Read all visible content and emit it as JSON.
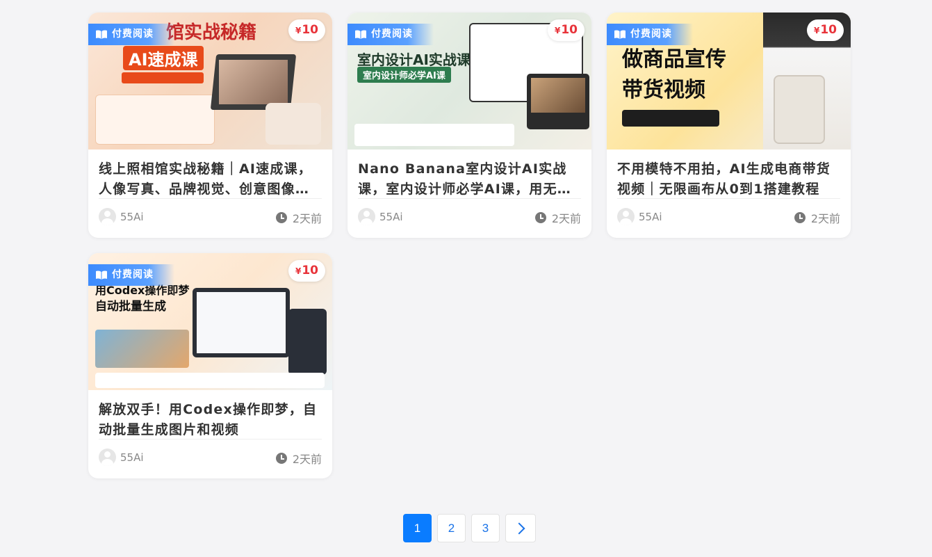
{
  "cards": [
    {
      "badge": "付费阅读",
      "price_symbol": "¥",
      "price": "10",
      "title": "线上照相馆实战秘籍｜AI速成课，人像写真、品牌视觉、创意图像一站式变现教学",
      "author": "55Ai",
      "time": "2天前",
      "thumb_caption": "馆实战秘籍",
      "thumb_sub": "AI速成课"
    },
    {
      "badge": "付费阅读",
      "price_symbol": "¥",
      "price": "10",
      "title": "Nano Banana室内设计AI实战课，室内设计师必学AI课，用无限画布快速出效果图",
      "author": "55Ai",
      "time": "2天前",
      "thumb_caption": "室内设计AI实战课",
      "thumb_sub": "室内设计师必学AI课"
    },
    {
      "badge": "付费阅读",
      "price_symbol": "¥",
      "price": "10",
      "title": "不用模特不用拍，AI生成电商带货视频｜无限画布从0到1搭建教程",
      "author": "55Ai",
      "time": "2天前",
      "thumb_caption": "做商品宣传",
      "thumb_sub": "带货视频"
    },
    {
      "badge": "付费阅读",
      "price_symbol": "¥",
      "price": "10",
      "title": "解放双手！用Codex操作即梦，自动批量生成图片和视频",
      "author": "55Ai",
      "time": "2天前",
      "thumb_caption": "用Codex操作即梦",
      "thumb_sub": "自动批量生成"
    }
  ],
  "pagination": {
    "pages": [
      "1",
      "2",
      "3"
    ],
    "current": "1",
    "next_icon": "chevron-right-icon"
  },
  "colors": {
    "accent": "#0a7cff",
    "badge": "#3d8bfd",
    "price": "#e8333a"
  }
}
